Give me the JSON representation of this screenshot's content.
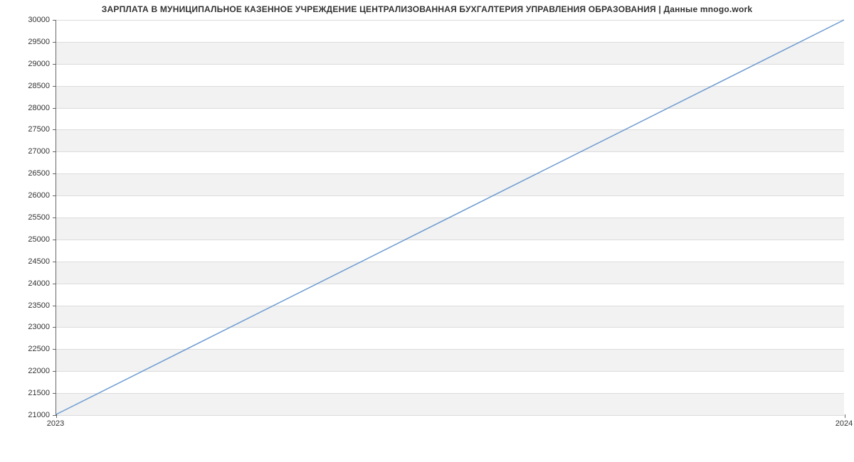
{
  "chart_data": {
    "type": "line",
    "title": "ЗАРПЛАТА В МУНИЦИПАЛЬНОЕ КАЗЕННОЕ УЧРЕЖДЕНИЕ ЦЕНТРАЛИЗОВАННАЯ БУХГАЛТЕРИЯ УПРАВЛЕНИЯ ОБРАЗОВАНИЯ | Данные mnogo.work",
    "x": [
      2023,
      2024
    ],
    "series": [
      {
        "name": "salary",
        "values": [
          21000,
          30000
        ],
        "color": "#6b9bd1"
      }
    ],
    "xlabel": "",
    "ylabel": "",
    "xlim": [
      2023,
      2024
    ],
    "ylim": [
      21000,
      30000
    ],
    "y_ticks": [
      21000,
      21500,
      22000,
      22500,
      23000,
      23500,
      24000,
      24500,
      25000,
      25500,
      26000,
      26500,
      27000,
      27500,
      28000,
      28500,
      29000,
      29500,
      30000
    ],
    "x_ticks": [
      2023,
      2024
    ],
    "grid": true
  }
}
